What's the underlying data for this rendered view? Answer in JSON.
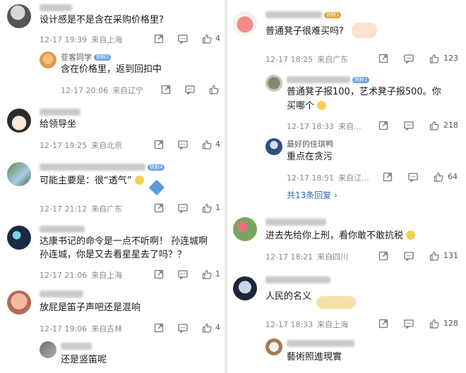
{
  "left": {
    "comments": [
      {
        "text": "设计感是不是含在采购价格里?",
        "date": "12-17 19:39",
        "location": "来自上海",
        "likes": "4"
      },
      {
        "reply_name": "亚客同学",
        "reply_badge": "铁粉1",
        "text": "含在价格里，返到回扣中",
        "date": "12-17 20:06",
        "location": "来自辽宁",
        "likes": ""
      },
      {
        "text": "给领导坐",
        "date": "12-17 19:25",
        "location": "来自北京",
        "likes": "4"
      },
      {
        "badge": "铁粉4",
        "text": "可能主要是：很“透气”",
        "date": "12-17 21:12",
        "location": "来自广东",
        "likes": "1"
      },
      {
        "text_line1": "达康书记的命令是一点不听啊！ 孙连城啊",
        "text_line2": "孙连城，你是又去看星星去了吗？？",
        "date": "12-17 21:06",
        "location": "来自上海",
        "likes": "1"
      },
      {
        "text": "放屁是笛子声吧还是混响",
        "date": "12-17 19:06",
        "location": "来自吉林",
        "likes": "4"
      },
      {
        "text": "还是竖笛呢"
      }
    ]
  },
  "right": {
    "comments": [
      {
        "badge": "铁粉1",
        "text": "普通凳子很难买吗?",
        "date": "12-17 18:25",
        "location": "来自广东",
        "likes": "123"
      },
      {
        "badge": "铁粉1",
        "text_line1": "普通凳子报100，艺术凳子报500。你",
        "text_line2": "买哪个",
        "date": "12-17 18:33",
        "location": "来自...",
        "likes": "218"
      },
      {
        "reply_name": "最好的佳琪鸭",
        "text": "重点在贪污",
        "date": "12-17 18:51",
        "location": "来自江...",
        "likes": "64"
      },
      {
        "more": "共13条回复 ›"
      },
      {
        "text": "进去先给你上刑，看你敢不敢抗税",
        "date": "12-17 18:21",
        "location": "来自四川",
        "likes": "131"
      },
      {
        "text": "人民的名义",
        "date": "12-17 18:33",
        "location": "来自上海",
        "likes": "128"
      },
      {
        "text": "藝術照進現實"
      }
    ]
  },
  "icons": [
    "share-icon",
    "comment-icon",
    "like-icon"
  ],
  "colors": {
    "link": "#2d6ab5",
    "badge": "#6aa0e6",
    "meta": "#8a8a8a"
  }
}
